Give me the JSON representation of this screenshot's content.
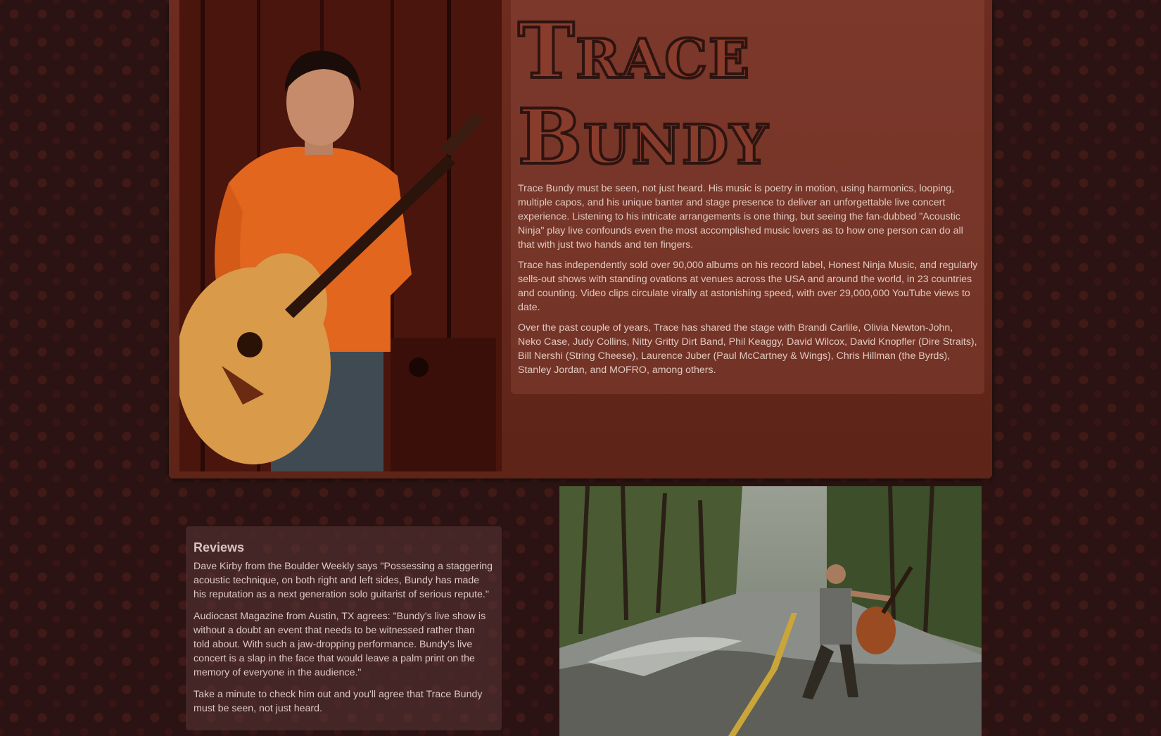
{
  "header": {
    "title_line1": "Trace",
    "title_line2": "Bundy"
  },
  "bio": {
    "paragraphs": [
      "Trace Bundy must be seen, not just heard. His music is poetry in motion, using harmonics, looping, multiple capos, and his unique banter and stage presence to deliver an unforgettable live concert experience. Listening to his intricate arrangements is one thing, but seeing the fan-dubbed \"Acoustic Ninja\" play live confounds even the most accomplished music lovers as to how one person can do all that with just two hands and ten fingers.",
      "Trace has independently sold over 90,000 albums on his record label, Honest Ninja Music, and regularly sells-out shows with standing ovations at venues across the USA and around the world, in 23 countries and counting. Video clips circulate virally at astonishing speed, with over 29,000,000 YouTube views to date.",
      "Over the past couple of years, Trace has shared the stage with Brandi Carlile, Olivia Newton-John, Neko Case, Judy Collins, Nitty Gritty Dirt Band, Phil Keaggy, David Wilcox, David Knopfler (Dire Straits), Bill Nershi (String Cheese), Laurence Juber (Paul McCartney & Wings), Chris Hillman (the Byrds), Stanley Jordan, and MOFRO, among others."
    ]
  },
  "reviews": {
    "heading": "Reviews",
    "paragraphs": [
      "Dave Kirby from the Boulder Weekly says \"Possessing a staggering acoustic technique, on both right and left sides, Bundy has made his reputation as a next generation solo guitarist of serious repute.\"",
      "Audiocast Magazine from Austin, TX agrees: \"Bundy's live show is without a doubt an event that needs to be witnessed rather than told about. With such a jaw-dropping performance. Bundy's live concert is a slap in the face that would leave a palm print on the memory of everyone in the audience.\"",
      "Take a minute to check him out and you'll agree that Trace Bundy must be seen, not just heard."
    ]
  },
  "colors": {
    "page_background": "#2a1312",
    "panel_background": "#6e2b1f",
    "title_fill": "#8a3c2c",
    "text": "#e0c8c0"
  }
}
